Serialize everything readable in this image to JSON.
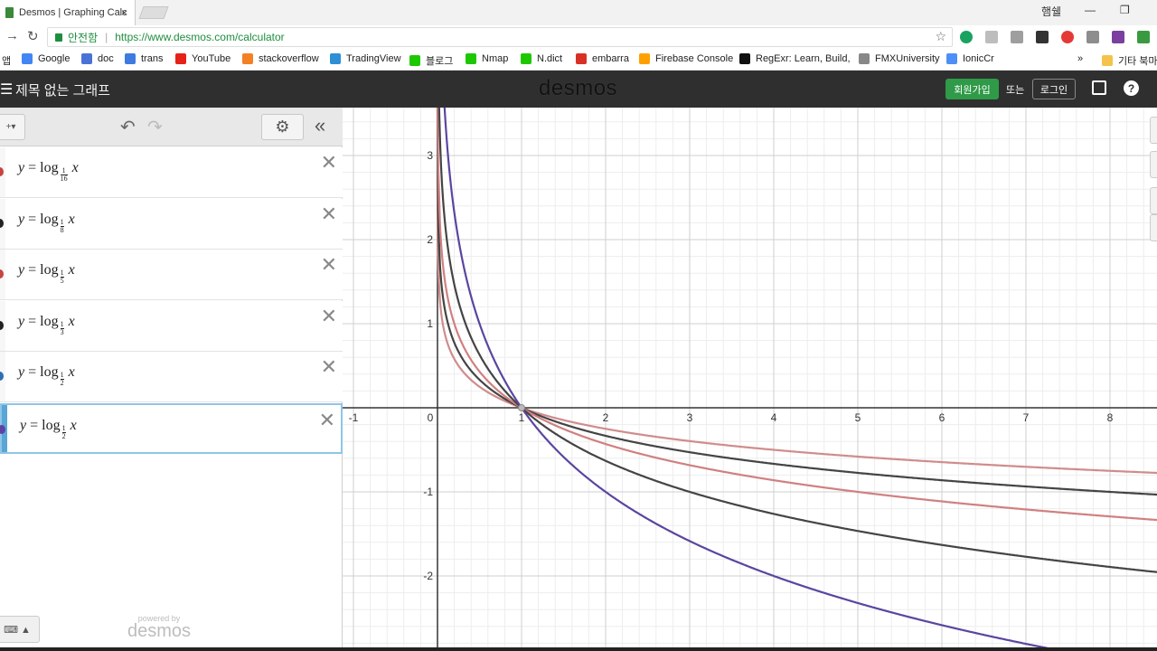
{
  "browser": {
    "tab_title": "Desmos | Graphing Calc",
    "tab_close": "×",
    "window_user": "햄쉘",
    "secure_label": "안전함",
    "url_host": "https://www.desmos.com",
    "url_path": "/calculator"
  },
  "bookmarks": [
    {
      "label": "앱",
      "color": "#6b6b6b"
    },
    {
      "label": "Google",
      "color": "#4285f4"
    },
    {
      "label": "doc",
      "color": "#4a72d6"
    },
    {
      "label": "trans",
      "color": "#3d7be0"
    },
    {
      "label": "YouTube",
      "color": "#e62117"
    },
    {
      "label": "stackoverflow",
      "color": "#f48024"
    },
    {
      "label": "TradingView",
      "color": "#2d8fd5"
    },
    {
      "label": "블로그",
      "color": "#1ec800"
    },
    {
      "label": "Nmap",
      "color": "#1ec800"
    },
    {
      "label": "N.dict",
      "color": "#1ec800"
    },
    {
      "label": "embarra",
      "color": "#d93025"
    },
    {
      "label": "Firebase Console",
      "color": "#ffa000"
    },
    {
      "label": "RegExr: Learn, Build,",
      "color": "#111111"
    },
    {
      "label": "FMXUniversity",
      "color": "#888888"
    },
    {
      "label": "IonicCr",
      "color": "#4e8ef7"
    },
    {
      "label": "»",
      "color": ""
    },
    {
      "label": "기타 북마",
      "color": "#f3c34a"
    }
  ],
  "header": {
    "graph_title": "제목 없는 그래프",
    "logo": "desmos",
    "signup": "회원가입",
    "or": "또는",
    "login": "로그인",
    "help": "?"
  },
  "panel": {
    "powered_small": "powered by",
    "powered_big": "desmos",
    "expressions": [
      {
        "lhs": "y",
        "fn": "log",
        "num": "1",
        "den": "16",
        "arg": "x",
        "color": "#c74440"
      },
      {
        "lhs": "y",
        "fn": "log",
        "num": "1",
        "den": "8",
        "arg": "x",
        "color": "#222222"
      },
      {
        "lhs": "y",
        "fn": "log",
        "num": "1",
        "den": "5",
        "arg": "x",
        "color": "#c74440"
      },
      {
        "lhs": "y",
        "fn": "log",
        "num": "1",
        "den": "3",
        "arg": "x",
        "color": "#222222"
      },
      {
        "lhs": "y",
        "fn": "log",
        "num": "1",
        "den": "2",
        "arg": "x",
        "color": "#2d70b3"
      },
      {
        "lhs": "y",
        "fn": "log",
        "num": "1",
        "den": "2",
        "arg": "x",
        "color": "#6042a6"
      }
    ]
  },
  "graph": {
    "x_ticks": [
      "-1",
      "0",
      "1",
      "2",
      "3",
      "4",
      "5",
      "6",
      "7",
      "8"
    ],
    "y_ticks": [
      "3",
      "2",
      "1",
      "-1",
      "-2"
    ],
    "curves": [
      {
        "base": 16,
        "color": "#d08c8c"
      },
      {
        "base": 8,
        "color": "#444444"
      },
      {
        "base": 5,
        "color": "#d08080"
      },
      {
        "base": 3,
        "color": "#444444"
      },
      {
        "base": 2,
        "color": "#5b45a0"
      }
    ]
  }
}
